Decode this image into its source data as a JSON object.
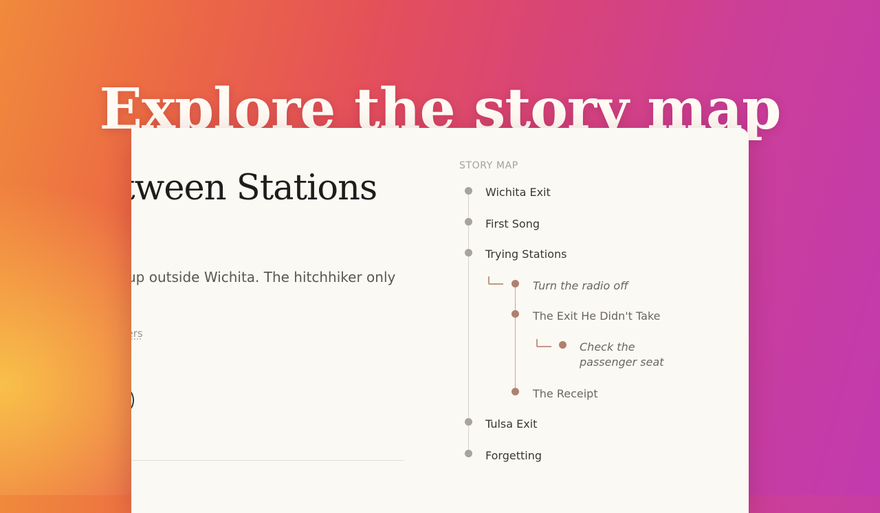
{
  "headline": "Explore the story map",
  "story": {
    "title_fragment": "etween Stations",
    "intro_fragment": "up outside Wichita. The hitchhiker only",
    "byline_fragment": "hers"
  },
  "story_map": {
    "heading": "STORY MAP",
    "items": [
      {
        "label": "Wichita Exit",
        "level": 0,
        "kind": "chapter"
      },
      {
        "label": "First Song",
        "level": 0,
        "kind": "chapter"
      },
      {
        "label": "Trying Stations",
        "level": 0,
        "kind": "chapter"
      },
      {
        "label": "Turn the radio off",
        "level": 1,
        "kind": "choice"
      },
      {
        "label": "The Exit He Didn't Take",
        "level": 1,
        "kind": "chapter"
      },
      {
        "label": "Check the passenger seat",
        "level": 2,
        "kind": "choice"
      },
      {
        "label": "The Receipt",
        "level": 1,
        "kind": "chapter"
      },
      {
        "label": "Tulsa Exit",
        "level": 0,
        "kind": "chapter"
      },
      {
        "label": "Forgetting",
        "level": 0,
        "kind": "chapter"
      }
    ]
  },
  "colors": {
    "panel_background": "#fbf9f3",
    "main_node": "#a7a39d",
    "branch_node": "#ad8170"
  },
  "icons": [
    "timeline-node",
    "branch-connector"
  ]
}
